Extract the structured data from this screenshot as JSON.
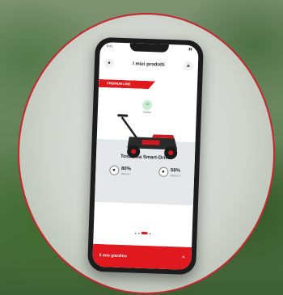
{
  "status": {
    "time": "9:41",
    "indicators": "▮▮"
  },
  "header": {
    "title": "I miei prodotti",
    "left_icon": "user-icon",
    "right_icon": "bell-icon"
  },
  "banner": {
    "label": "PREMIUM-LINE"
  },
  "connection": {
    "label": "Online",
    "icon": "wifi-icon"
  },
  "product": {
    "name": "Tosaerba Smart-Drive",
    "stats": [
      {
        "value": "80%",
        "label": "Batteria 1",
        "icon": "battery-icon"
      },
      {
        "value": "58%",
        "label": "Batteria 2",
        "icon": "battery-icon"
      }
    ]
  },
  "pagination": {
    "count": 4,
    "active": 2
  },
  "bottom": {
    "label": "Il mio giardino",
    "chevron": "^"
  },
  "colors": {
    "accent": "#e0191f",
    "ring": "#c8262b"
  }
}
